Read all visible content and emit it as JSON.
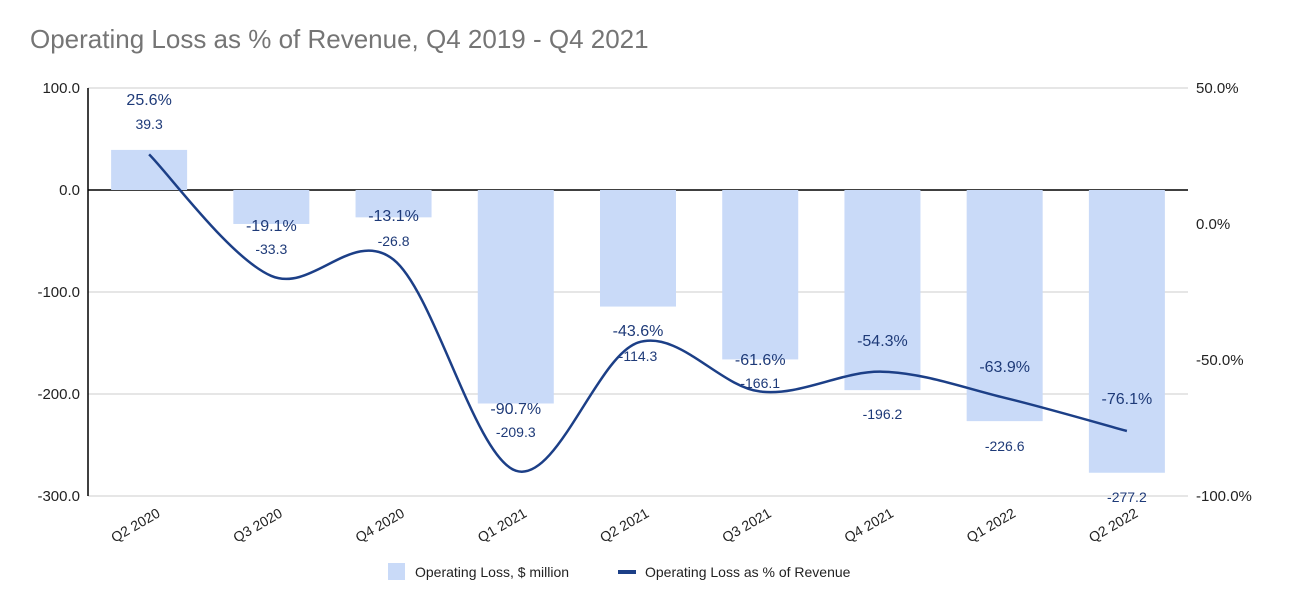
{
  "chart_data": {
    "type": "bar+line",
    "title": "Operating Loss as % of Revenue, Q4 2019 - Q4 2021",
    "categories": [
      "Q2 2020",
      "Q3 2020",
      "Q4 2020",
      "Q1 2021",
      "Q2 2021",
      "Q3 2021",
      "Q4 2021",
      "Q1 2022",
      "Q2 2022"
    ],
    "series": [
      {
        "name": "Operating Loss, $ million",
        "type": "bar",
        "axis": "left",
        "color": "#c9daf8",
        "values": [
          39.3,
          -33.3,
          -26.8,
          -209.3,
          -114.3,
          -166.1,
          -196.2,
          -226.6,
          -277.2
        ],
        "labels": [
          "39.3",
          "-33.3",
          "-26.8",
          "-209.3",
          "-114.3",
          "-166.1",
          "-196.2",
          "-226.6",
          "-277.2"
        ]
      },
      {
        "name": "Operating Loss as % of Revenue",
        "type": "line",
        "axis": "right",
        "color": "#1c3f87",
        "smooth": true,
        "values": [
          25.6,
          -19.1,
          -13.1,
          -90.7,
          -43.6,
          -61.6,
          -54.3,
          -63.9,
          -76.1
        ],
        "labels": [
          "25.6%",
          "-19.1%",
          "-13.1%",
          "-90.7%",
          "-43.6%",
          "-61.6%",
          "-54.3%",
          "-63.9%",
          "-76.1%"
        ]
      }
    ],
    "left_axis": {
      "ylim": [
        -300,
        100
      ],
      "ticks": [
        "100.0",
        "0.0",
        "-100.0",
        "-200.0",
        "-300.0"
      ]
    },
    "right_axis": {
      "ylim": [
        -100,
        50
      ],
      "ticks": [
        "50.0%",
        "0.0%",
        "-50.0%",
        "-100.0%"
      ]
    },
    "grid": true,
    "legend": "bottom"
  }
}
